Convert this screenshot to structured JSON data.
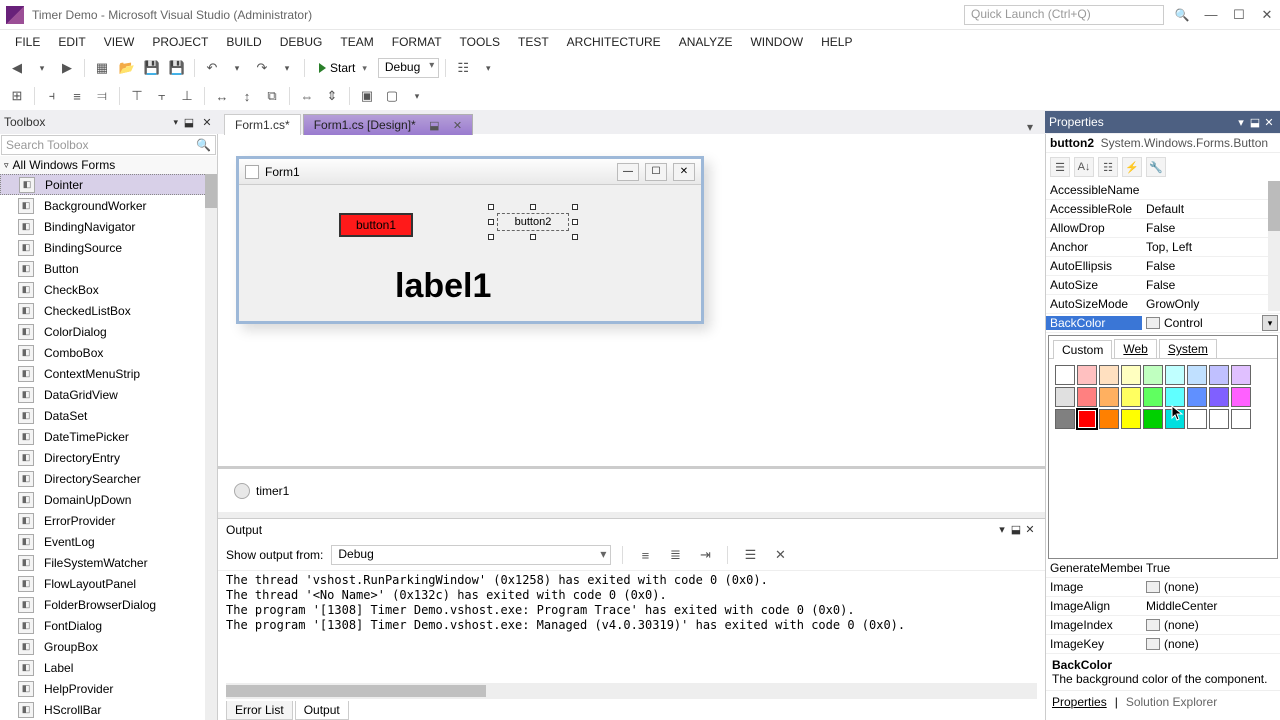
{
  "window": {
    "title": "Timer Demo - Microsoft Visual Studio (Administrator)",
    "quick_launch_placeholder": "Quick Launch (Ctrl+Q)"
  },
  "menubar": [
    "FILE",
    "EDIT",
    "VIEW",
    "PROJECT",
    "BUILD",
    "DEBUG",
    "TEAM",
    "FORMAT",
    "TOOLS",
    "TEST",
    "ARCHITECTURE",
    "ANALYZE",
    "WINDOW",
    "HELP"
  ],
  "toolbar": {
    "start_label": "Start",
    "config": "Debug"
  },
  "panels": {
    "toolbox_title": "Toolbox",
    "search_placeholder": "Search Toolbox",
    "category": "All Windows Forms",
    "properties_title": "Properties",
    "output_title": "Output",
    "error_list": "Error List",
    "output_tab": "Output",
    "properties_tab": "Properties",
    "solution_tab": "Solution Explorer"
  },
  "toolbox_items": [
    "Pointer",
    "BackgroundWorker",
    "BindingNavigator",
    "BindingSource",
    "Button",
    "CheckBox",
    "CheckedListBox",
    "ColorDialog",
    "ComboBox",
    "ContextMenuStrip",
    "DataGridView",
    "DataSet",
    "DateTimePicker",
    "DirectoryEntry",
    "DirectorySearcher",
    "DomainUpDown",
    "ErrorProvider",
    "EventLog",
    "FileSystemWatcher",
    "FlowLayoutPanel",
    "FolderBrowserDialog",
    "FontDialog",
    "GroupBox",
    "Label",
    "HelpProvider",
    "HScrollBar"
  ],
  "tabs": [
    {
      "name": "Form1.cs*"
    },
    {
      "name": "Form1.cs [Design]*"
    }
  ],
  "designer": {
    "form_title": "Form1",
    "button1_text": "button1",
    "button2_text": "button2",
    "label1_text": "label1",
    "tray_item": "timer1"
  },
  "output": {
    "show_from_label": "Show output from:",
    "show_from_value": "Debug",
    "lines": [
      "The thread 'vshost.RunParkingWindow' (0x1258) has exited with code 0 (0x0).",
      "The thread '<No Name>' (0x132c) has exited with code 0 (0x0).",
      "The program '[1308] Timer Demo.vshost.exe: Program Trace' has exited with code 0 (0x0).",
      "The program '[1308] Timer Demo.vshost.exe: Managed (v4.0.30319)' has exited with code 0 (0x0)."
    ]
  },
  "properties": {
    "object_name": "button2",
    "object_type": "System.Windows.Forms.Button",
    "rows_top": [
      {
        "k": "AccessibleName",
        "v": ""
      },
      {
        "k": "AccessibleRole",
        "v": "Default"
      },
      {
        "k": "AllowDrop",
        "v": "False"
      },
      {
        "k": "Anchor",
        "v": "Top, Left"
      },
      {
        "k": "AutoEllipsis",
        "v": "False"
      },
      {
        "k": "AutoSize",
        "v": "False"
      },
      {
        "k": "AutoSizeMode",
        "v": "GrowOnly"
      }
    ],
    "selected": {
      "k": "BackColor",
      "v": "Control"
    },
    "rows_bottom": [
      {
        "k": "GenerateMember",
        "v": "True"
      },
      {
        "k": "Image",
        "v": "(none)",
        "swatch": true
      },
      {
        "k": "ImageAlign",
        "v": "MiddleCenter"
      },
      {
        "k": "ImageIndex",
        "v": "(none)",
        "swatch": true
      },
      {
        "k": "ImageKey",
        "v": "(none)",
        "swatch": true
      }
    ],
    "help_name": "BackColor",
    "help_desc": "The background color of the component."
  },
  "picker": {
    "tabs": [
      "Custom",
      "Web",
      "System"
    ],
    "selected_tab": "Custom",
    "colors_row1": [
      "#ffffff",
      "#ffc0c0",
      "#ffe0c0",
      "#ffffc0",
      "#c0ffc0",
      "#c0ffff",
      "#c0e0ff",
      "#c0c0ff",
      "#e0c0ff"
    ],
    "colors_row2": [
      "#e0e0e0",
      "#ff8080",
      "#ffb060",
      "#ffff60",
      "#60ff60",
      "#60ffff",
      "#6090ff",
      "#8060ff",
      "#ff60ff"
    ],
    "colors_row3": [
      "#808080",
      "#ff0000",
      "#ff8000",
      "#ffff00",
      "#00d000",
      "#00e0e0",
      "#ffffff",
      "#ffffff",
      "#ffffff"
    ],
    "selected_color": "#ff0000"
  }
}
